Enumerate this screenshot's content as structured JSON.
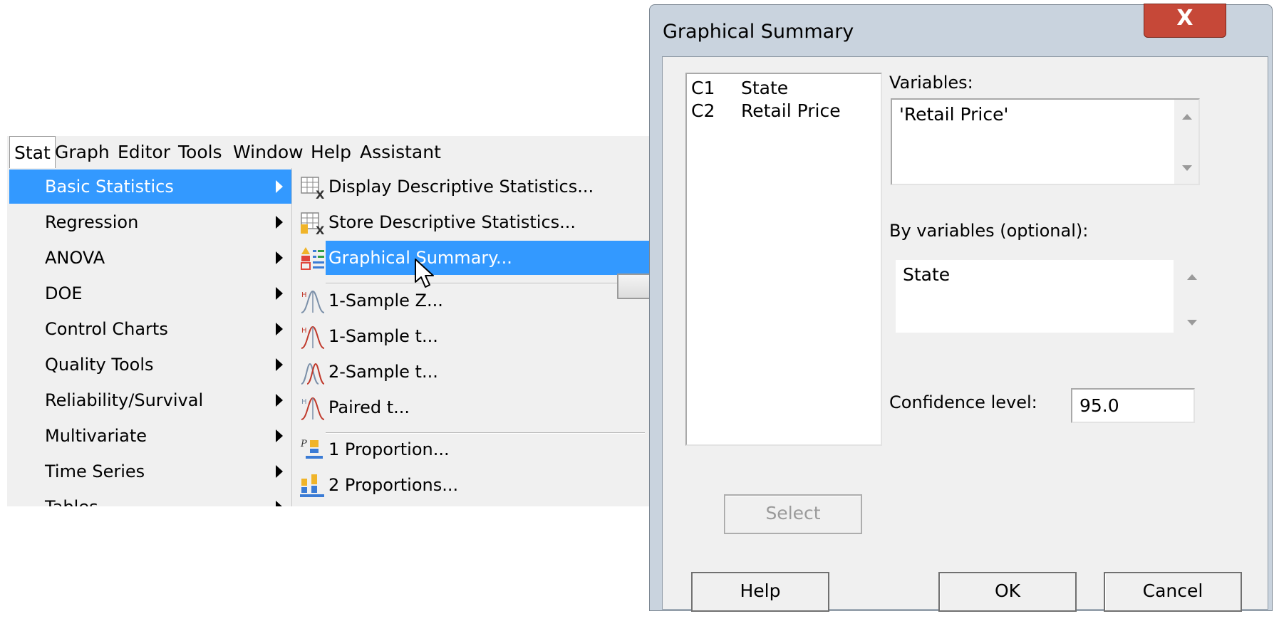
{
  "menubar": {
    "items": [
      "Stat",
      "Graph",
      "Editor",
      "Tools",
      "Window",
      "Help",
      "Assistant"
    ]
  },
  "stat_menu": {
    "items": [
      {
        "label": "Basic Statistics",
        "highlighted": true
      },
      {
        "label": "Regression"
      },
      {
        "label": "ANOVA"
      },
      {
        "label": "DOE"
      },
      {
        "label": "Control Charts"
      },
      {
        "label": "Quality Tools"
      },
      {
        "label": "Reliability/Survival"
      },
      {
        "label": "Multivariate"
      },
      {
        "label": "Time Series"
      },
      {
        "label": "Tables"
      }
    ]
  },
  "basic_stats_submenu": {
    "items": [
      {
        "label": "Display Descriptive Statistics...",
        "icon": "table-x-icon"
      },
      {
        "label": "Store Descriptive Statistics...",
        "icon": "table-store-icon"
      },
      {
        "label": "Graphical Summary...",
        "icon": "graphical-summary-icon",
        "highlighted": true
      },
      {
        "label": "1-Sample Z...",
        "icon": "one-sample-z-icon"
      },
      {
        "label": "1-Sample t...",
        "icon": "one-sample-t-icon"
      },
      {
        "label": "2-Sample t...",
        "icon": "two-sample-t-icon"
      },
      {
        "label": "Paired t...",
        "icon": "paired-t-icon"
      },
      {
        "label": "1 Proportion...",
        "icon": "one-proportion-icon"
      },
      {
        "label": "2 Proportions...",
        "icon": "two-proportions-icon"
      }
    ]
  },
  "dialog": {
    "title": "Graphical Summary",
    "close_glyph": "X",
    "columns": [
      {
        "id": "C1",
        "name": "State"
      },
      {
        "id": "C2",
        "name": "Retail Price"
      }
    ],
    "variables_label": "Variables:",
    "variables_value": "'Retail Price'",
    "by_variables_label": "By variables (optional):",
    "by_variables_value": "State",
    "confidence_label": "Confidence level:",
    "confidence_value": "95.0",
    "select_button": "Select",
    "help_button": "Help",
    "ok_button": "OK",
    "cancel_button": "Cancel"
  },
  "colors": {
    "highlight": "#3399ff",
    "close_button": "#c64838",
    "dialog_frame": "#c9d3de"
  }
}
